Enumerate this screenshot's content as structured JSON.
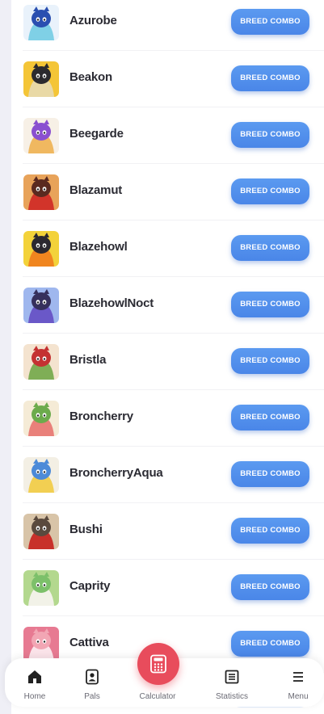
{
  "pals": [
    {
      "name": "Azurobe",
      "button": "BREED COMBO",
      "colors": [
        "#2a4fb0",
        "#7fd0e6",
        "#e9f2fb"
      ]
    },
    {
      "name": "Beakon",
      "button": "BREED COMBO",
      "colors": [
        "#2b2a2e",
        "#e9d9a6",
        "#f4c537"
      ]
    },
    {
      "name": "Beegarde",
      "button": "BREED COMBO",
      "colors": [
        "#8a4fd0",
        "#f0b860",
        "#f7f0e6"
      ]
    },
    {
      "name": "Blazamut",
      "button": "BREED COMBO",
      "colors": [
        "#5a2a20",
        "#d2342a",
        "#e8a35a"
      ]
    },
    {
      "name": "Blazehowl",
      "button": "BREED COMBO",
      "colors": [
        "#2b2830",
        "#f0851f",
        "#f3d23a"
      ]
    },
    {
      "name": "BlazehowlNoct",
      "button": "BREED COMBO",
      "colors": [
        "#36305c",
        "#6a58c8",
        "#9fb7ee"
      ]
    },
    {
      "name": "Bristla",
      "button": "BREED COMBO",
      "colors": [
        "#c43232",
        "#7fae56",
        "#f4e3cf"
      ]
    },
    {
      "name": "Broncherry",
      "button": "BREED COMBO",
      "colors": [
        "#6cab4c",
        "#e9807a",
        "#f5ebd6"
      ]
    },
    {
      "name": "BroncherryAqua",
      "button": "BREED COMBO",
      "colors": [
        "#4c8ad8",
        "#f2cf52",
        "#f3efe4"
      ]
    },
    {
      "name": "Bushi",
      "button": "BREED COMBO",
      "colors": [
        "#5a4a3e",
        "#c8302a",
        "#d8c4a8"
      ]
    },
    {
      "name": "Caprity",
      "button": "BREED COMBO",
      "colors": [
        "#7cc06a",
        "#f2f2e8",
        "#b3d88e"
      ]
    },
    {
      "name": "Cattiva",
      "button": "BREED COMBO",
      "colors": [
        "#f2a6b4",
        "#fbe4ea",
        "#e77a92"
      ]
    }
  ],
  "nav": {
    "home": "Home",
    "pals": "Pals",
    "calculator": "Calculator",
    "statistics": "Statistics",
    "menu": "Menu"
  },
  "accent": "#4a86e8",
  "fab_color": "#e84c5c"
}
